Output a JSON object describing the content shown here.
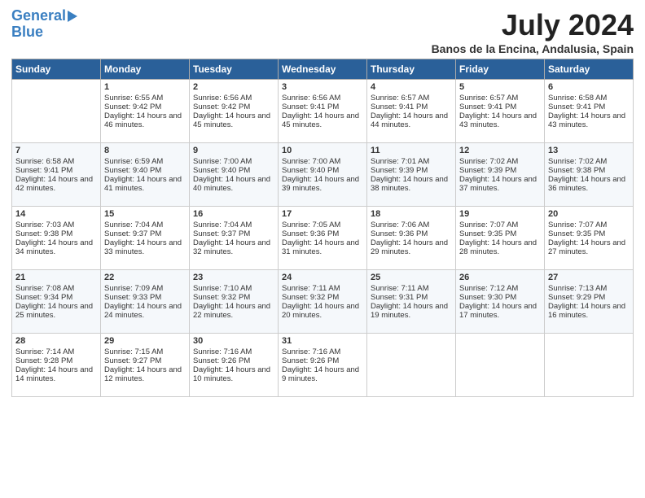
{
  "logo": {
    "line1": "General",
    "line2": "Blue"
  },
  "header": {
    "month_year": "July 2024",
    "location": "Banos de la Encina, Andalusia, Spain"
  },
  "days_of_week": [
    "Sunday",
    "Monday",
    "Tuesday",
    "Wednesday",
    "Thursday",
    "Friday",
    "Saturday"
  ],
  "weeks": [
    [
      {
        "day": "",
        "sunrise": "",
        "sunset": "",
        "daylight": ""
      },
      {
        "day": "1",
        "sunrise": "Sunrise: 6:55 AM",
        "sunset": "Sunset: 9:42 PM",
        "daylight": "Daylight: 14 hours and 46 minutes."
      },
      {
        "day": "2",
        "sunrise": "Sunrise: 6:56 AM",
        "sunset": "Sunset: 9:42 PM",
        "daylight": "Daylight: 14 hours and 45 minutes."
      },
      {
        "day": "3",
        "sunrise": "Sunrise: 6:56 AM",
        "sunset": "Sunset: 9:41 PM",
        "daylight": "Daylight: 14 hours and 45 minutes."
      },
      {
        "day": "4",
        "sunrise": "Sunrise: 6:57 AM",
        "sunset": "Sunset: 9:41 PM",
        "daylight": "Daylight: 14 hours and 44 minutes."
      },
      {
        "day": "5",
        "sunrise": "Sunrise: 6:57 AM",
        "sunset": "Sunset: 9:41 PM",
        "daylight": "Daylight: 14 hours and 43 minutes."
      },
      {
        "day": "6",
        "sunrise": "Sunrise: 6:58 AM",
        "sunset": "Sunset: 9:41 PM",
        "daylight": "Daylight: 14 hours and 43 minutes."
      }
    ],
    [
      {
        "day": "7",
        "sunrise": "Sunrise: 6:58 AM",
        "sunset": "Sunset: 9:41 PM",
        "daylight": "Daylight: 14 hours and 42 minutes."
      },
      {
        "day": "8",
        "sunrise": "Sunrise: 6:59 AM",
        "sunset": "Sunset: 9:40 PM",
        "daylight": "Daylight: 14 hours and 41 minutes."
      },
      {
        "day": "9",
        "sunrise": "Sunrise: 7:00 AM",
        "sunset": "Sunset: 9:40 PM",
        "daylight": "Daylight: 14 hours and 40 minutes."
      },
      {
        "day": "10",
        "sunrise": "Sunrise: 7:00 AM",
        "sunset": "Sunset: 9:40 PM",
        "daylight": "Daylight: 14 hours and 39 minutes."
      },
      {
        "day": "11",
        "sunrise": "Sunrise: 7:01 AM",
        "sunset": "Sunset: 9:39 PM",
        "daylight": "Daylight: 14 hours and 38 minutes."
      },
      {
        "day": "12",
        "sunrise": "Sunrise: 7:02 AM",
        "sunset": "Sunset: 9:39 PM",
        "daylight": "Daylight: 14 hours and 37 minutes."
      },
      {
        "day": "13",
        "sunrise": "Sunrise: 7:02 AM",
        "sunset": "Sunset: 9:38 PM",
        "daylight": "Daylight: 14 hours and 36 minutes."
      }
    ],
    [
      {
        "day": "14",
        "sunrise": "Sunrise: 7:03 AM",
        "sunset": "Sunset: 9:38 PM",
        "daylight": "Daylight: 14 hours and 34 minutes."
      },
      {
        "day": "15",
        "sunrise": "Sunrise: 7:04 AM",
        "sunset": "Sunset: 9:37 PM",
        "daylight": "Daylight: 14 hours and 33 minutes."
      },
      {
        "day": "16",
        "sunrise": "Sunrise: 7:04 AM",
        "sunset": "Sunset: 9:37 PM",
        "daylight": "Daylight: 14 hours and 32 minutes."
      },
      {
        "day": "17",
        "sunrise": "Sunrise: 7:05 AM",
        "sunset": "Sunset: 9:36 PM",
        "daylight": "Daylight: 14 hours and 31 minutes."
      },
      {
        "day": "18",
        "sunrise": "Sunrise: 7:06 AM",
        "sunset": "Sunset: 9:36 PM",
        "daylight": "Daylight: 14 hours and 29 minutes."
      },
      {
        "day": "19",
        "sunrise": "Sunrise: 7:07 AM",
        "sunset": "Sunset: 9:35 PM",
        "daylight": "Daylight: 14 hours and 28 minutes."
      },
      {
        "day": "20",
        "sunrise": "Sunrise: 7:07 AM",
        "sunset": "Sunset: 9:35 PM",
        "daylight": "Daylight: 14 hours and 27 minutes."
      }
    ],
    [
      {
        "day": "21",
        "sunrise": "Sunrise: 7:08 AM",
        "sunset": "Sunset: 9:34 PM",
        "daylight": "Daylight: 14 hours and 25 minutes."
      },
      {
        "day": "22",
        "sunrise": "Sunrise: 7:09 AM",
        "sunset": "Sunset: 9:33 PM",
        "daylight": "Daylight: 14 hours and 24 minutes."
      },
      {
        "day": "23",
        "sunrise": "Sunrise: 7:10 AM",
        "sunset": "Sunset: 9:32 PM",
        "daylight": "Daylight: 14 hours and 22 minutes."
      },
      {
        "day": "24",
        "sunrise": "Sunrise: 7:11 AM",
        "sunset": "Sunset: 9:32 PM",
        "daylight": "Daylight: 14 hours and 20 minutes."
      },
      {
        "day": "25",
        "sunrise": "Sunrise: 7:11 AM",
        "sunset": "Sunset: 9:31 PM",
        "daylight": "Daylight: 14 hours and 19 minutes."
      },
      {
        "day": "26",
        "sunrise": "Sunrise: 7:12 AM",
        "sunset": "Sunset: 9:30 PM",
        "daylight": "Daylight: 14 hours and 17 minutes."
      },
      {
        "day": "27",
        "sunrise": "Sunrise: 7:13 AM",
        "sunset": "Sunset: 9:29 PM",
        "daylight": "Daylight: 14 hours and 16 minutes."
      }
    ],
    [
      {
        "day": "28",
        "sunrise": "Sunrise: 7:14 AM",
        "sunset": "Sunset: 9:28 PM",
        "daylight": "Daylight: 14 hours and 14 minutes."
      },
      {
        "day": "29",
        "sunrise": "Sunrise: 7:15 AM",
        "sunset": "Sunset: 9:27 PM",
        "daylight": "Daylight: 14 hours and 12 minutes."
      },
      {
        "day": "30",
        "sunrise": "Sunrise: 7:16 AM",
        "sunset": "Sunset: 9:26 PM",
        "daylight": "Daylight: 14 hours and 10 minutes."
      },
      {
        "day": "31",
        "sunrise": "Sunrise: 7:16 AM",
        "sunset": "Sunset: 9:26 PM",
        "daylight": "Daylight: 14 hours and 9 minutes."
      },
      {
        "day": "",
        "sunrise": "",
        "sunset": "",
        "daylight": ""
      },
      {
        "day": "",
        "sunrise": "",
        "sunset": "",
        "daylight": ""
      },
      {
        "day": "",
        "sunrise": "",
        "sunset": "",
        "daylight": ""
      }
    ]
  ]
}
